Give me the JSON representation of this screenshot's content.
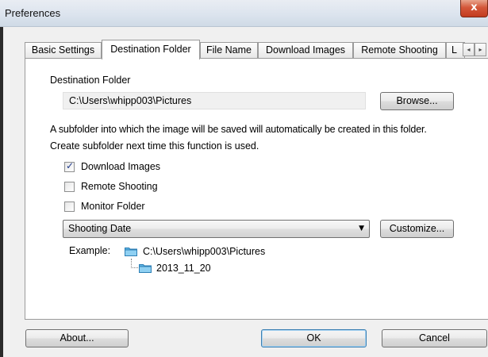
{
  "window": {
    "title": "Preferences",
    "close_glyph": "x"
  },
  "tabs": [
    {
      "label": "Basic Settings"
    },
    {
      "label": "Destination Folder"
    },
    {
      "label": "File Name"
    },
    {
      "label": "Download Images"
    },
    {
      "label": "Remote Shooting"
    },
    {
      "label": "L"
    }
  ],
  "tab_scroll": {
    "left": "◂",
    "right": "▸"
  },
  "destination": {
    "heading": "Destination Folder",
    "path": "C:\\Users\\whipp003\\Pictures",
    "browse_label": "Browse..."
  },
  "subfolder": {
    "description_line1": "A subfolder into which the image will be saved will automatically be created in this folder.",
    "description_line2": "Create subfolder next time this function is used.",
    "options": [
      {
        "label": "Download Images",
        "checked": true
      },
      {
        "label": "Remote Shooting",
        "checked": false
      },
      {
        "label": "Monitor Folder",
        "checked": false
      }
    ],
    "format_selected": "Shooting Date",
    "customize_label": "Customize...",
    "example_label": "Example:",
    "example_root": "C:\\Users\\whipp003\\Pictures",
    "example_child": "2013_11_20"
  },
  "footer": {
    "about_label": "About...",
    "ok_label": "OK",
    "cancel_label": "Cancel"
  },
  "colors": {
    "folder": "#4aa3d8",
    "check": "#1f3a8a"
  }
}
